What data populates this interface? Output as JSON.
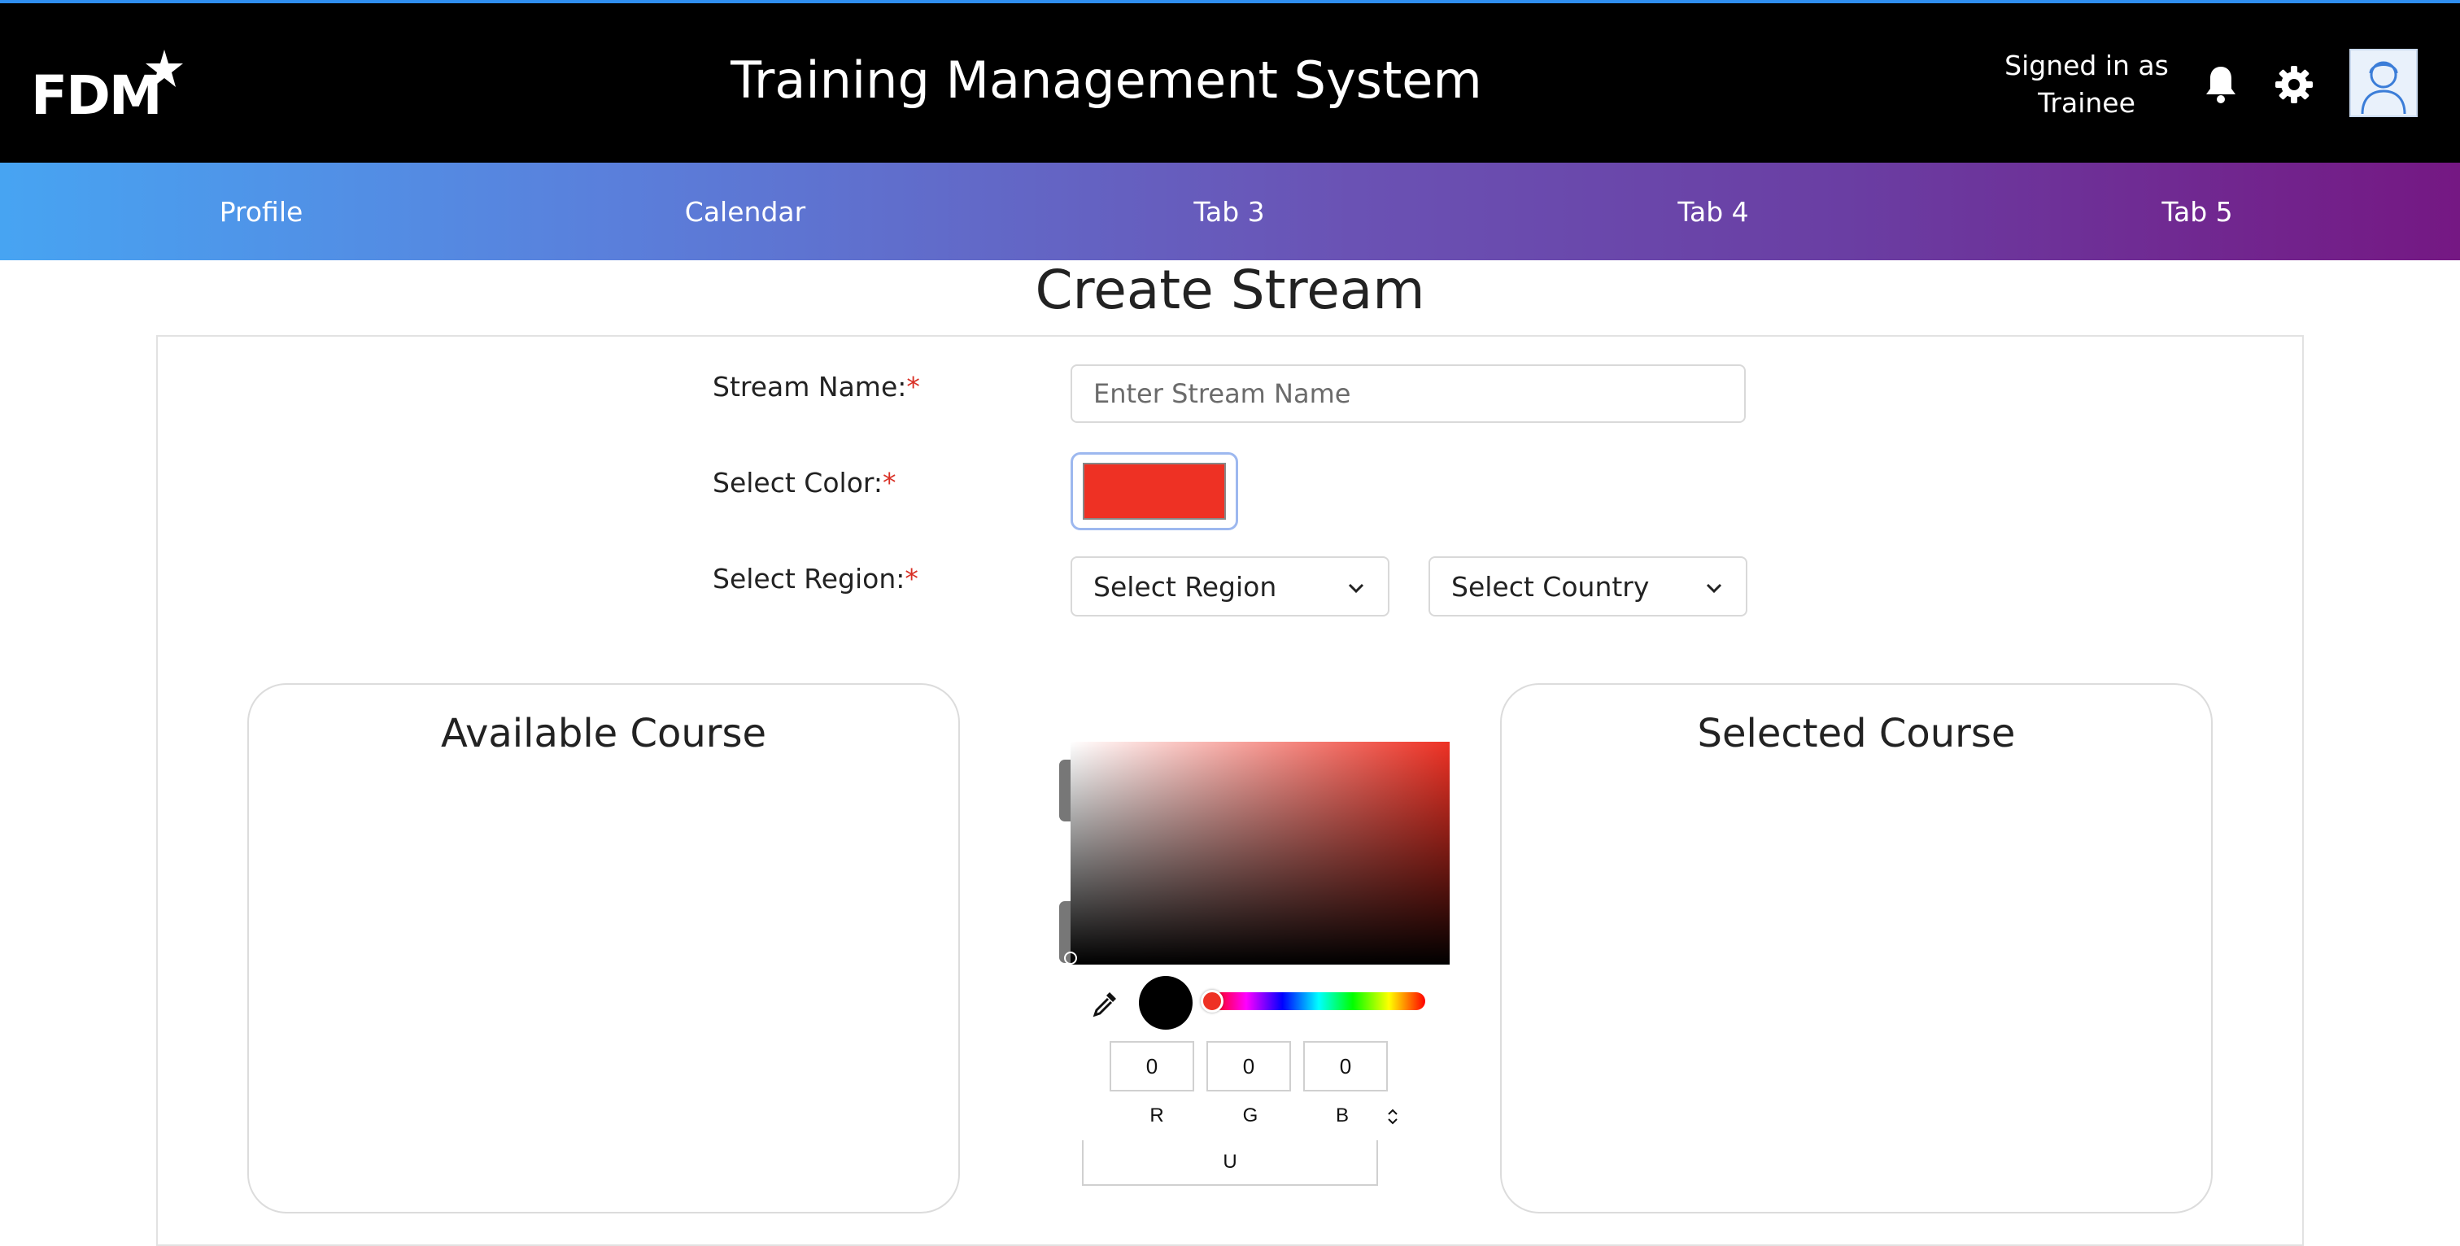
{
  "header": {
    "logo_text": "FDM",
    "app_title": "Training Management System",
    "signed_in_line1": "Signed in as",
    "signed_in_line2": "Trainee",
    "icons": [
      "bell-icon",
      "gear-icon",
      "avatar-icon"
    ]
  },
  "nav": {
    "tabs": [
      {
        "label": "Profile"
      },
      {
        "label": "Calendar"
      },
      {
        "label": "Tab 3"
      },
      {
        "label": "Tab 4"
      },
      {
        "label": "Tab 5"
      }
    ],
    "gradient_start": "#47a4f2",
    "gradient_end": "#751883"
  },
  "page": {
    "title": "Create Stream"
  },
  "form": {
    "stream_name_label": "Stream Name:",
    "stream_name_placeholder": "Enter Stream Name",
    "stream_name_value": "",
    "color_label": "Select Color:",
    "color_value": "#ee3124",
    "region_label": "Select Region:",
    "region_select": "Select Region",
    "country_select": "Select Country",
    "required_mark": "*"
  },
  "courses": {
    "available_title": "Available Course",
    "selected_title": "Selected Course"
  },
  "color_picker": {
    "hue_color": "#ee3124",
    "preview_color": "#000000",
    "r": "0",
    "g": "0",
    "b": "0",
    "r_label": "R",
    "g_label": "G",
    "b_label": "B",
    "bottom_text": "U"
  }
}
